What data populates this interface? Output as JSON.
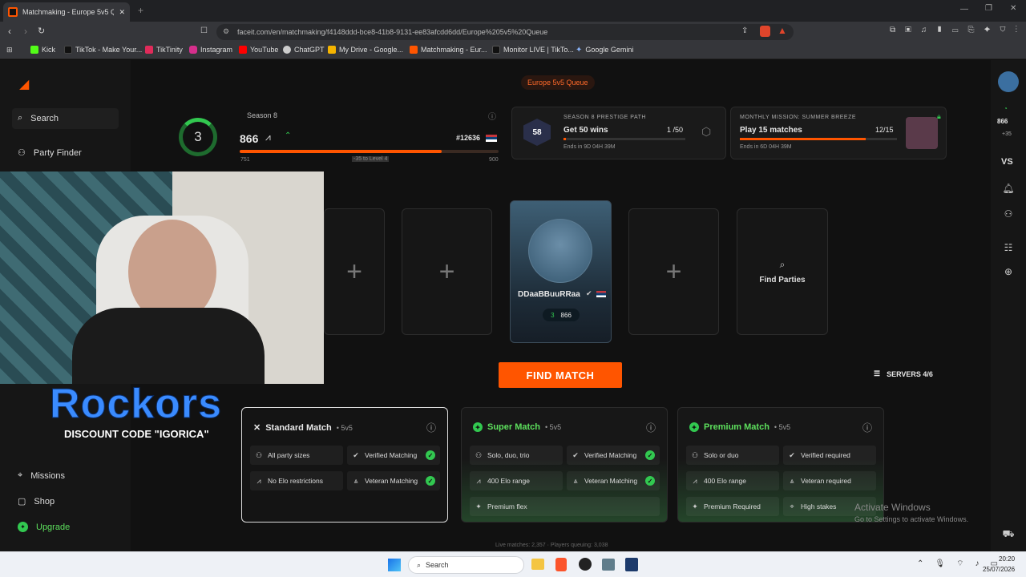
{
  "browser": {
    "tab_title": "Matchmaking - Europe 5v5 Que",
    "url": "faceit.com/en/matchmaking/f4148ddd-bce8-41b8-9131-ee83afcdd6dd/Europe%205v5%20Queue",
    "bookmarks": [
      "Kick",
      "TikTok - Make Your...",
      "TikTinity",
      "Instagram",
      "YouTube",
      "ChatGPT",
      "My Drive - Google...",
      "Matchmaking - Eur...",
      "Monitor LIVE | TikTo...",
      "Google Gemini"
    ]
  },
  "sidebar": {
    "search": "Search",
    "party_finder": "Party Finder",
    "missions": "Missions",
    "shop": "Shop",
    "upgrade": "Upgrade"
  },
  "queue_title": "Europe 5v5 Queue",
  "player": {
    "season": "Season 8",
    "level": "3",
    "elo": "866",
    "rank": "#12636",
    "bar_min": "751",
    "bar_max": "900",
    "bar_label": "-35 to Level 4",
    "progress": 0.78
  },
  "prestige": {
    "label": "SEASON 8 PRESTIGE PATH",
    "badge": "58",
    "task": "Get 50 wins",
    "count": "1 /50",
    "ends": "Ends in 9D 04H 39M"
  },
  "monthly": {
    "label": "MONTHLY MISSION: SUMMER BREEZE",
    "task": "Play 15 matches",
    "count": "12/15",
    "ends": "Ends in 6D 04H 39M"
  },
  "party": {
    "name": "DDaaBBuuRRaa",
    "level": "3",
    "elo": "866",
    "find_parties": "Find Parties"
  },
  "find_match": "FIND MATCH",
  "servers": "SERVERS 4/6",
  "modes": [
    {
      "title": "Standard Match",
      "sub": "• 5v5",
      "f": [
        "All party sizes",
        "Verified Matching",
        "No Elo restrictions",
        "Veteran Matching"
      ]
    },
    {
      "title": "Super Match",
      "sub": "• 5v5",
      "f": [
        "Solo, duo, trio",
        "Verified Matching",
        "400 Elo range",
        "Veteran Matching",
        "Premium flex"
      ]
    },
    {
      "title": "Premium Match",
      "sub": "• 5v5",
      "f": [
        "Solo or duo",
        "Verified required",
        "400 Elo range",
        "Veteran required",
        "Premium Required",
        "High stakes"
      ]
    }
  ],
  "right_bar": {
    "elo": "866",
    "plus": "+35",
    "vs": "VS"
  },
  "overlay": {
    "brand": "Rockors",
    "code": "DISCOUNT CODE \"IGORICA\""
  },
  "watermark": {
    "line1": "Activate Windows",
    "line2": "Go to Settings to activate Windows."
  },
  "footer_stats": "Live matches: 2,357 · Players queuing: 3,038",
  "taskbar": {
    "search": "Search",
    "time": "20:20",
    "date": "25/07/2026"
  }
}
